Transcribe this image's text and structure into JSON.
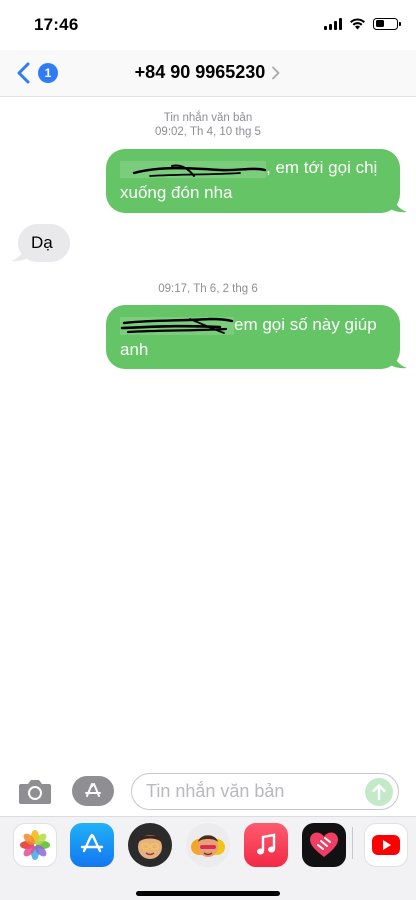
{
  "status_bar": {
    "time": "17:46"
  },
  "nav": {
    "back_badge": "1",
    "contact": "+84 90 9965230"
  },
  "messages": {
    "header1_type": "Tin nhắn văn bản",
    "header1_time": "09:02, Th 4, 10 thg 5",
    "msg1_line1": ", em tới gọi chị",
    "msg1_line2": "xuống đón nha",
    "msg2": "Dạ",
    "header2_time": "09:17, Th 6, 2 thg 6",
    "msg3_line1": "em gọi số này giúp",
    "msg3_line2": "anh"
  },
  "input": {
    "placeholder": "Tin nhắn văn bản"
  },
  "apps": [
    "photos-app",
    "app-store-app",
    "memoji-app",
    "animoji-app",
    "music-app",
    "digital-touch-app",
    "youtube-app"
  ],
  "colors": {
    "sent_bubble": "#65c466",
    "received_bubble": "#e9e9eb",
    "accent": "#2f7cf6"
  }
}
